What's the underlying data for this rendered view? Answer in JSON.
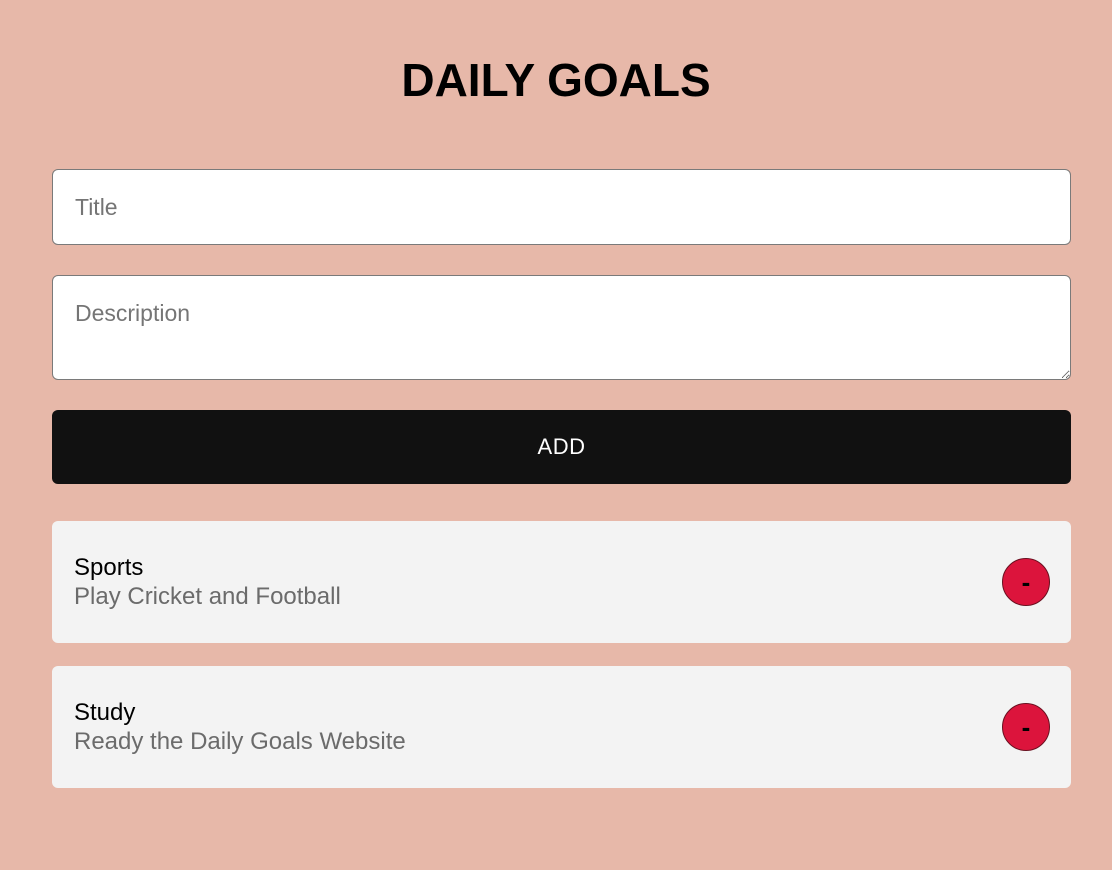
{
  "header": {
    "title": "DAILY GOALS"
  },
  "form": {
    "title_placeholder": "Title",
    "title_value": "",
    "description_placeholder": "Description",
    "description_value": "",
    "add_label": "ADD"
  },
  "goals": [
    {
      "title": "Sports",
      "description": "Play Cricket and Football",
      "remove_label": "-"
    },
    {
      "title": "Study",
      "description": "Ready the Daily Goals Website",
      "remove_label": "-"
    }
  ],
  "colors": {
    "background": "#e7b8a9",
    "button": "#111111",
    "card": "#f3f3f3",
    "remove": "#dc143c"
  }
}
